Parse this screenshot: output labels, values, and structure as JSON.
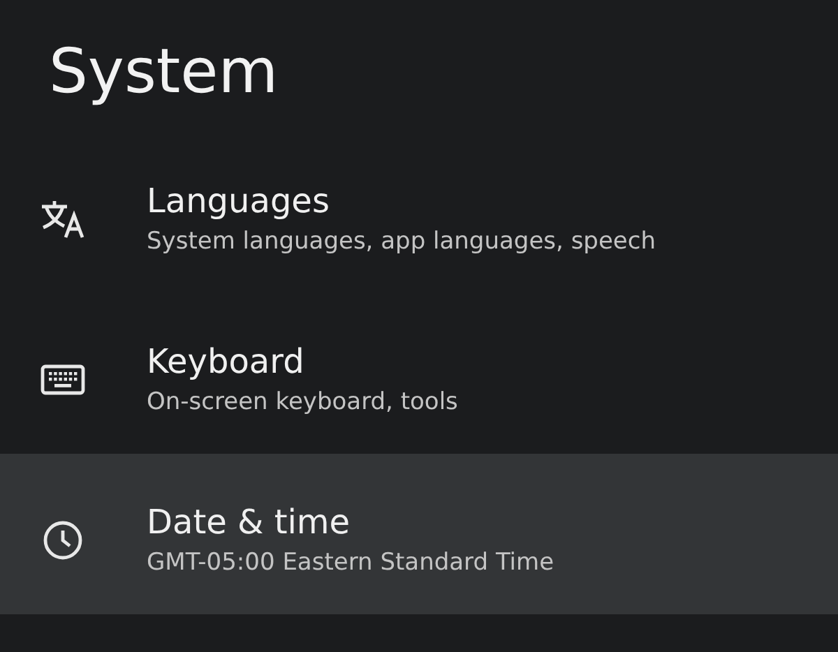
{
  "title": "System",
  "items": [
    {
      "label": "Languages",
      "summary": "System languages, app languages, speech",
      "selected": false
    },
    {
      "label": "Keyboard",
      "summary": "On-screen keyboard, tools",
      "selected": false
    },
    {
      "label": "Date & time",
      "summary": "GMT-05:00 Eastern Standard Time",
      "selected": true
    }
  ]
}
